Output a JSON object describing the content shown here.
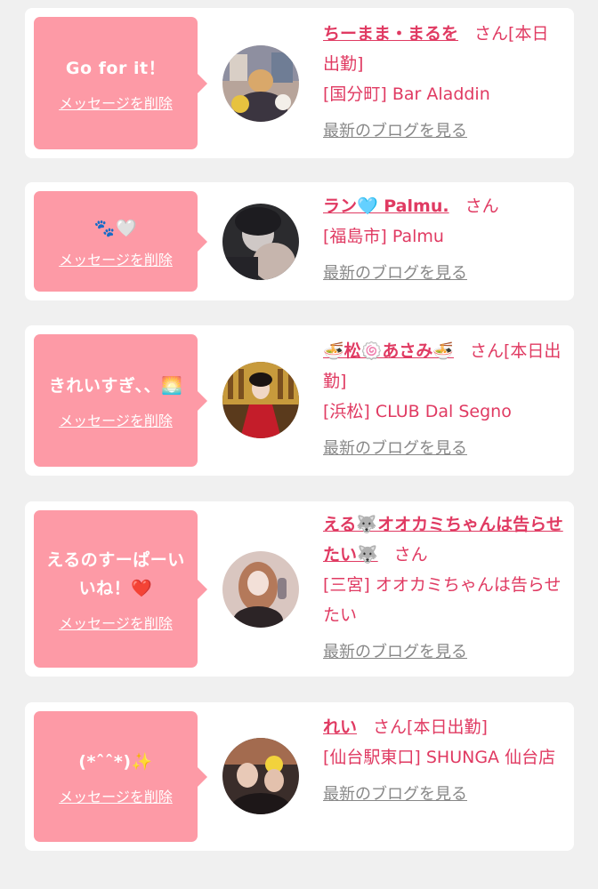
{
  "colors": {
    "bubble": "#fd9aa6",
    "accent": "#e03a62",
    "link_gray": "#888888",
    "background": "#f0f0f0"
  },
  "delete_label": "メッセージを削除",
  "blog_label": "最新のブログを見る",
  "san_label": "さん",
  "cards": [
    {
      "message": "Go for it！",
      "name": "ちーまま・まるを",
      "working": "[本日出勤]",
      "place": "[国分町] Bar Aladdin"
    },
    {
      "message": "🐾🤍",
      "name": "ラン🩵 Palmu.",
      "working": "",
      "place": "[福島市] Palmu"
    },
    {
      "message": "きれいすぎ、、🌅",
      "name": "🍜松🍥あさみ🍜",
      "working": "[本日出勤]",
      "place": "[浜松] CLUB Dal Segno"
    },
    {
      "message": "えるのすーぱーいいね！❤️",
      "name": "える🐺オオカミちゃんは告らせたい🐺",
      "working": "",
      "place": "[三宮] オオカミちゃんは告らせたい"
    },
    {
      "message": "(*ˆˆ*)✨",
      "name": "れい",
      "working": "[本日出勤]",
      "place": "[仙台駅東口] SHUNGA 仙台店"
    }
  ]
}
